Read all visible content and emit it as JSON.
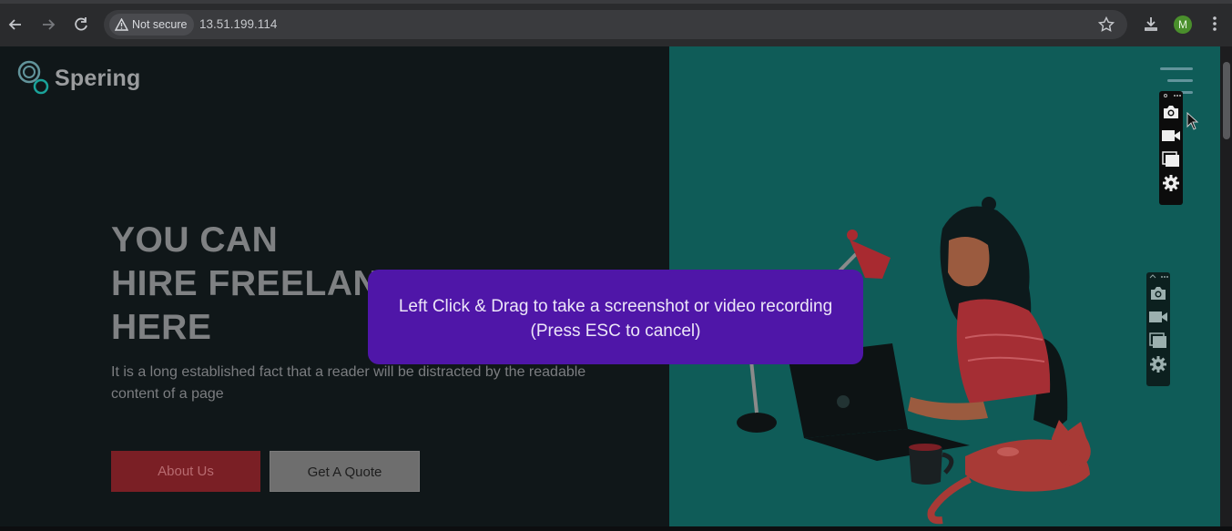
{
  "browser": {
    "security_label": "Not secure",
    "url": "13.51.199.114",
    "avatar_letter": "M"
  },
  "site": {
    "logo_text": "Spering",
    "hero_lines": [
      "YOU CAN",
      "HIRE FREELANCER",
      "HERE"
    ],
    "subtext": "It is a long established fact that a reader will be distracted by the readable content of a page",
    "about_button": "About Us",
    "quote_button": "Get A Quote"
  },
  "overlay": {
    "line1": "Left Click & Drag to take a screenshot or video recording",
    "line2": "(Press ESC to cancel)"
  },
  "colors": {
    "left_panel": "#101719",
    "right_panel": "#0f5c58",
    "overlay": "#4f16a8",
    "about_button": "#7a1f25"
  },
  "icons": [
    "back-arrow-icon",
    "forward-arrow-icon",
    "reload-icon",
    "warning-icon",
    "star-icon",
    "download-icon",
    "kebab-menu-icon",
    "hamburger-menu-icon",
    "camera-icon",
    "video-camera-icon",
    "windows-icon",
    "gear-icon"
  ]
}
